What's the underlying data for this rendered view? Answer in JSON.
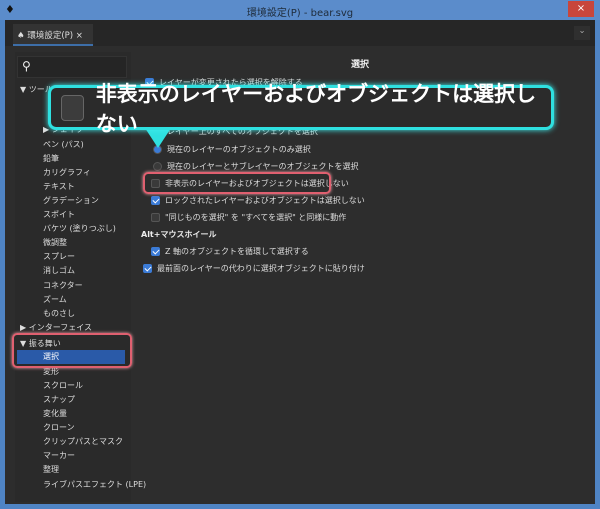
{
  "window": {
    "title": "環境設定(P) - bear.svg",
    "close_label": "×"
  },
  "tab": {
    "label": "環境設定(P)",
    "close": "×"
  },
  "search": {
    "icon": "search-icon",
    "value": ""
  },
  "tree": [
    {
      "label": "▼ ツール",
      "level": 0
    },
    {
      "label": "▶ シェイプ",
      "level": 1
    },
    {
      "label": "ペン (パス)",
      "level": 1
    },
    {
      "label": "鉛筆",
      "level": 1
    },
    {
      "label": "カリグラフィ",
      "level": 1
    },
    {
      "label": "テキスト",
      "level": 1
    },
    {
      "label": "グラデーション",
      "level": 1
    },
    {
      "label": "スポイト",
      "level": 1
    },
    {
      "label": "バケツ (塗りつぶし)",
      "level": 1
    },
    {
      "label": "微調整",
      "level": 1
    },
    {
      "label": "スプレー",
      "level": 1
    },
    {
      "label": "消しゴム",
      "level": 1
    },
    {
      "label": "コネクター",
      "level": 1
    },
    {
      "label": "ズーム",
      "level": 1
    },
    {
      "label": "ものさし",
      "level": 1
    },
    {
      "label": "▶ インターフェイス",
      "level": 0
    },
    {
      "label": "▼ 振る舞い",
      "level": 0
    },
    {
      "label": "選択",
      "level": 1,
      "selected": true
    },
    {
      "label": "変形",
      "level": 1
    },
    {
      "label": "スクロール",
      "level": 1
    },
    {
      "label": "スナップ",
      "level": 1
    },
    {
      "label": "変化量",
      "level": 1
    },
    {
      "label": "クローン",
      "level": 1
    },
    {
      "label": "クリップパスとマスク",
      "level": 1
    },
    {
      "label": "マーカー",
      "level": 1
    },
    {
      "label": "整理",
      "level": 1
    },
    {
      "label": "ライブパスエフェクト (LPE)",
      "level": 1
    }
  ],
  "main": {
    "title": "選択",
    "options": [
      {
        "type": "checkbox",
        "checked": true,
        "label": "レイヤーが変更されたら選択を解除する"
      },
      {
        "type": "radio",
        "checked": false,
        "label": "レイヤー上のすべてのオブジェクトを選択"
      },
      {
        "type": "radio",
        "checked": true,
        "label": "現在のレイヤーのオブジェクトのみ選択"
      },
      {
        "type": "radio",
        "checked": false,
        "label": "現在のレイヤーとサブレイヤーのオブジェクトを選択"
      },
      {
        "type": "checkbox",
        "checked": false,
        "label": "非表示のレイヤーおよびオブジェクトは選択しない"
      },
      {
        "type": "checkbox",
        "checked": true,
        "label": "ロックされたレイヤーおよびオブジェクトは選択しない"
      },
      {
        "type": "checkbox",
        "checked": false,
        "label": "\"同じものを選択\" を \"すべてを選択\" と同様に動作"
      }
    ],
    "section2": "Alt+マウスホイール",
    "options2": [
      {
        "checked": true,
        "label": "Z 軸のオブジェクトを循環して選択する"
      },
      {
        "checked": true,
        "label": "最前面のレイヤーの代わりに選択オブジェクトに貼り付け"
      }
    ]
  },
  "callout": {
    "label": "非表示のレイヤーおよびオブジェクトは選択しない"
  },
  "colors": {
    "accent": "#2a5aa8",
    "highlight": "#2fe0e0",
    "annotation": "#e06070"
  }
}
